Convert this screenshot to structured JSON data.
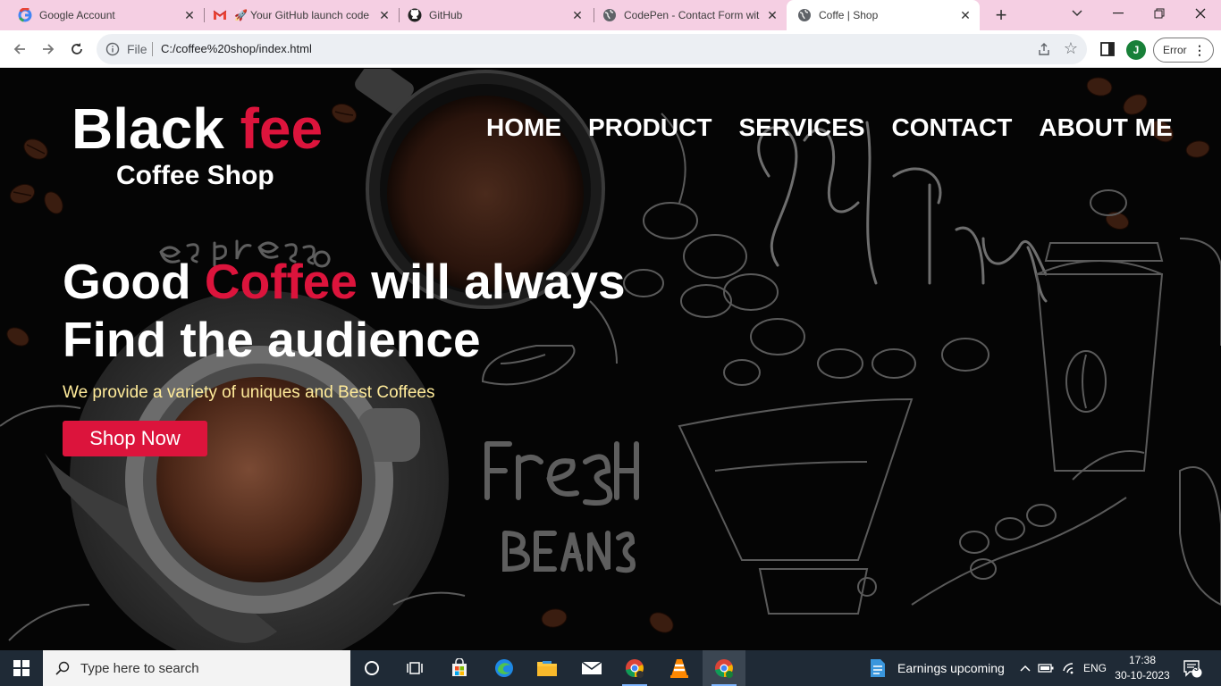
{
  "browser": {
    "tabs": [
      {
        "title": "Google Account",
        "icon": "google-icon",
        "active": false
      },
      {
        "title": "🚀 Your GitHub launch code",
        "icon": "gmail-icon",
        "active": false
      },
      {
        "title": "GitHub",
        "icon": "github-icon",
        "active": false
      },
      {
        "title": "CodePen - Contact Form wit",
        "icon": "globe-icon",
        "active": false
      },
      {
        "title": "Coffe | Shop",
        "icon": "globe-icon",
        "active": true
      }
    ],
    "new_tab": "+",
    "address": {
      "scheme_label": "File",
      "url": "C:/coffee%20shop/index.html"
    },
    "profile_initial": "J",
    "error_label": "Error"
  },
  "site": {
    "brand": {
      "part1": "Black ",
      "part2": "fee",
      "subtitle": "Coffee Shop"
    },
    "nav": [
      "HOME",
      "PRODUCT",
      "SERVICES",
      "CONTACT",
      "ABOUT ME"
    ],
    "hero": {
      "line1_a": "Good ",
      "line1_b": "Coffee",
      "line1_c": " will always",
      "line2": "Find the audience",
      "tagline": "We provide a variety of uniques and Best Coffees",
      "cta": "Shop Now"
    },
    "colors": {
      "accent": "#dc143c",
      "tagline": "#ffeb9a"
    }
  },
  "taskbar": {
    "search_placeholder": "Type here to search",
    "weather": "Earnings upcoming",
    "language": "ENG",
    "time": "17:38",
    "date": "30-10-2023",
    "notification_count": "3"
  }
}
